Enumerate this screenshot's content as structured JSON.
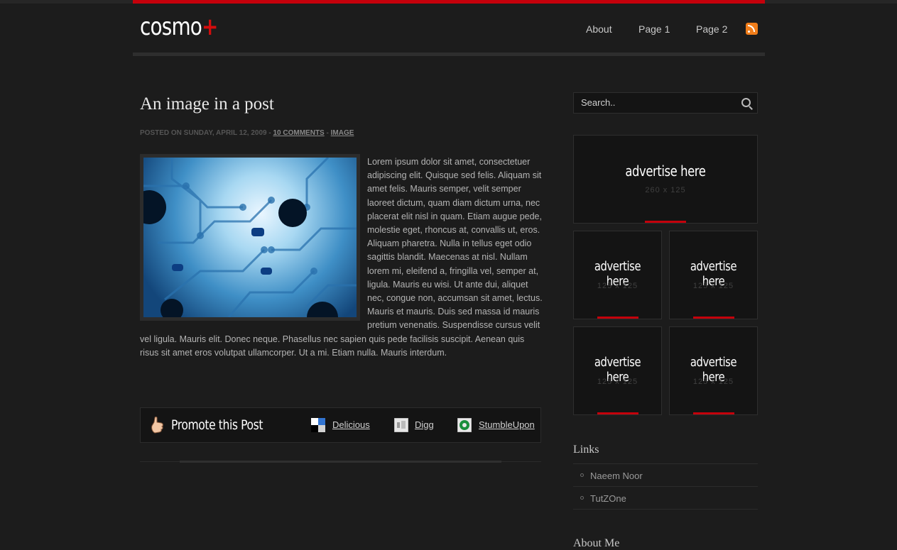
{
  "brand": {
    "logo_text": "cosmo",
    "logo_plus": "+"
  },
  "nav": {
    "items": [
      "About",
      "Page 1",
      "Page 2"
    ],
    "rss_icon": "rss-icon"
  },
  "post": {
    "title": "An image in a post",
    "meta_prefix": "POSTED ON SUNDAY, APRIL 12, 2009 -",
    "comments_link": "10 COMMENTS",
    "meta_sep": "-",
    "category_link": "IMAGE",
    "body": "Lorem ipsum dolor sit amet, consectetuer adipiscing elit. Quisque sed felis. Aliquam sit amet felis. Mauris semper, velit semper laoreet dictum, quam diam dictum urna, nec placerat elit nisl in quam. Etiam augue pede, molestie eget, rhoncus at, convallis ut, eros. Aliquam pharetra. Nulla in tellus eget odio sagittis blandit. Maecenas at nisl. Nullam lorem mi, eleifend a, fringilla vel, semper at, ligula. Mauris eu wisi. Ut ante dui, aliquet nec, congue non, accumsan sit amet, lectus. Mauris et mauris. Duis sed massa id mauris pretium venenatis. Suspendisse cursus velit vel ligula. Mauris elit. Donec neque. Phasellus nec sapien quis pede facilisis suscipit. Aenean quis risus sit amet eros volutpat ullamcorper. Ut a mi. Etiam nulla. Mauris interdum."
  },
  "promote": {
    "label": "Promote this Post",
    "shares": [
      "Delicious",
      "Digg",
      "StumbleUpon"
    ]
  },
  "sidebar": {
    "search_placeholder": "Search..",
    "ads": {
      "large": {
        "title": "advertise here",
        "size": "260 x 125"
      },
      "small": [
        {
          "title": "advertise here",
          "size": "125 x 125"
        },
        {
          "title": "advertise here",
          "size": "125 x 125"
        },
        {
          "title": "advertise here",
          "size": "125 x 125"
        },
        {
          "title": "advertise here",
          "size": "125 x 125"
        }
      ]
    },
    "links_title": "Links",
    "links": [
      "Naeem Noor",
      "TutZOne"
    ],
    "about_title": "About Me"
  },
  "colors": {
    "accent": "#c4000b",
    "background": "#1c1c1c"
  }
}
